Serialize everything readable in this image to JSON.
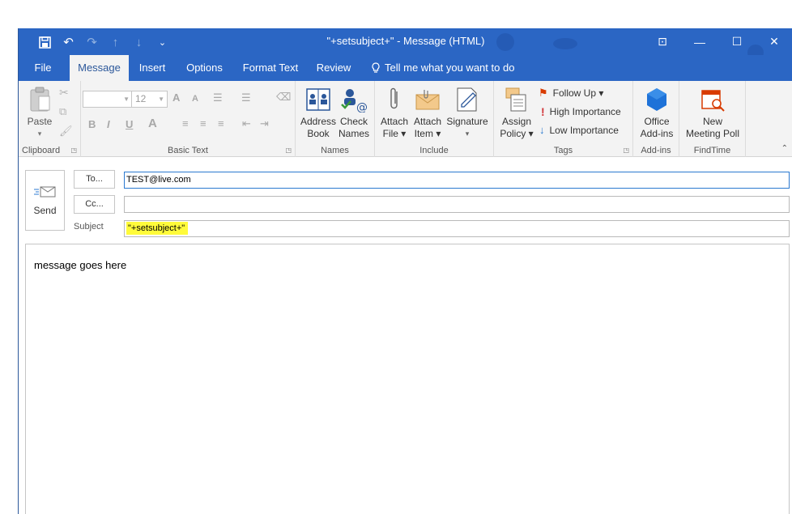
{
  "window": {
    "title": "\"+setsubject+\"  -  Message (HTML)",
    "accent": "#2b66c4"
  },
  "qat": {
    "icons": [
      "save-icon",
      "undo-icon",
      "redo-icon",
      "up-arrow-icon",
      "down-arrow-icon",
      "customize-qat-icon"
    ],
    "save": "🖫",
    "undo": "↶",
    "redo": "↷",
    "up": "↑",
    "down": "↓",
    "customize": "⌄"
  },
  "window_controls": {
    "ribbon_options": "⊡",
    "minimize": "—",
    "maximize": "☐",
    "close": "✕"
  },
  "tabs": [
    {
      "label": "File"
    },
    {
      "label": "Message"
    },
    {
      "label": "Insert"
    },
    {
      "label": "Options"
    },
    {
      "label": "Format Text"
    },
    {
      "label": "Review"
    }
  ],
  "tell_me": {
    "label": "Tell me what you want to do",
    "icon": "lightbulb-icon",
    "glyph": "💡"
  },
  "ribbon": {
    "clipboard": {
      "label": "Clipboard",
      "paste": "Paste",
      "paste_glyph": "📋",
      "dropdown": "▾"
    },
    "basic_text": {
      "label": "Basic Text",
      "font_name": "",
      "font_size": "12",
      "bold": "B",
      "italic": "I",
      "underline": "U",
      "grow": "A",
      "shrink": "A",
      "color_a": "A"
    },
    "names": {
      "label": "Names",
      "address_book": "Address\nBook",
      "address_book_l1": "Address",
      "address_book_l2": "Book",
      "check_names_l1": "Check",
      "check_names_l2": "Names"
    },
    "include": {
      "label": "Include",
      "attach_file_l1": "Attach",
      "attach_file_l2": "File ▾",
      "attach_item_l1": "Attach",
      "attach_item_l2": "Item ▾",
      "signature": "Signature",
      "signature_dd": "▾"
    },
    "tags": {
      "label": "Tags",
      "assign_policy_l1": "Assign",
      "assign_policy_l2": "Policy ▾",
      "follow_up": "Follow Up ▾",
      "high_importance": "High Importance",
      "low_importance": "Low Importance"
    },
    "addins": {
      "label": "Add-ins",
      "office_l1": "Office",
      "office_l2": "Add-ins"
    },
    "findtime": {
      "label": "FindTime",
      "new_l1": "New",
      "new_l2": "Meeting Poll"
    },
    "collapse": "⌃"
  },
  "compose": {
    "send": "Send",
    "to_button": "To...",
    "cc_button": "Cc...",
    "subject_label": "Subject",
    "to_value": "TEST@live.com",
    "cc_value": "",
    "subject_value": "\"+setsubject+\"",
    "body": "message goes here",
    "highlight_color": "#fffb3a"
  }
}
